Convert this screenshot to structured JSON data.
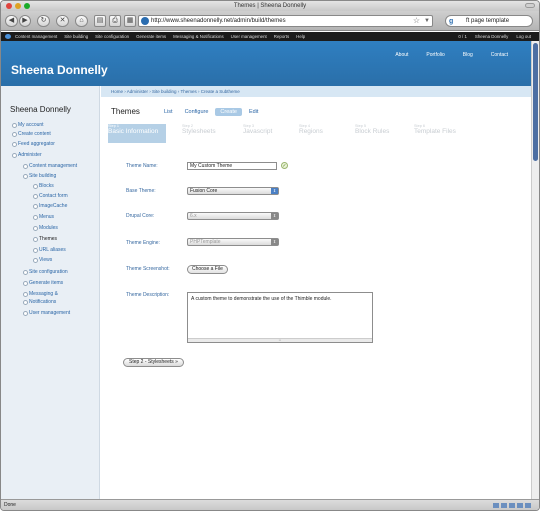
{
  "window": {
    "title": "Themes | Sheena Donnelly"
  },
  "browser": {
    "url": "http://www.sheenadonnelly.net/admin/build/themes",
    "search_text": "ft page template",
    "status": "Done"
  },
  "admin_menu": {
    "items": [
      "Content management",
      "Site building",
      "Site configuration",
      "Generate items",
      "Messaging & Notifications",
      "User management",
      "Reports",
      "Help"
    ],
    "counter": "0 / 1",
    "user": "Sheena Donnelly",
    "logout": "Log out"
  },
  "header": {
    "site_name": "Sheena Donnelly",
    "nav": [
      "About",
      "Portfolio",
      "Blog",
      "Contact"
    ]
  },
  "sidebar": {
    "title": "Sheena Donnelly",
    "items": [
      {
        "label": "My account"
      },
      {
        "label": "Create content"
      },
      {
        "label": "Feed aggregator"
      },
      {
        "label": "Administer"
      },
      {
        "label": "Content management"
      },
      {
        "label": "Site building"
      },
      {
        "label": "Blocks"
      },
      {
        "label": "Contact form"
      },
      {
        "label": "ImageCache"
      },
      {
        "label": "Menus"
      },
      {
        "label": "Modules"
      },
      {
        "label": "Themes"
      },
      {
        "label": "URL aliases"
      },
      {
        "label": "Views"
      },
      {
        "label": "Site configuration"
      },
      {
        "label": "Generate items"
      },
      {
        "label": "Messaging &"
      },
      {
        "label": "Notifications"
      },
      {
        "label": "User management"
      }
    ]
  },
  "content": {
    "breadcrumb": "Home › Administer › Site building › Themes › Create a Subtheme",
    "title": "Themes",
    "tabs": [
      "List",
      "Configure",
      "Create",
      "Edit"
    ],
    "steps": [
      {
        "num": "Step 1",
        "title": "Basic Information"
      },
      {
        "num": "Step 2",
        "title": "Stylesheets"
      },
      {
        "num": "Step 3",
        "title": "Javascript"
      },
      {
        "num": "Step 4",
        "title": "Regions"
      },
      {
        "num": "Step 5",
        "title": "Block Rules"
      },
      {
        "num": "Step 6",
        "title": "Template Files"
      }
    ],
    "form": {
      "theme_name_label": "Theme Name:",
      "theme_name_value": "My Custom Theme",
      "base_theme_label": "Base Theme:",
      "base_theme_value": "Fusion Core",
      "drupal_core_label": "Drupal Core:",
      "drupal_core_value": "6.x",
      "theme_engine_label": "Theme Engine:",
      "theme_engine_value": "PHPTemplate",
      "screenshot_label": "Theme Screenshot:",
      "choose_file": "Choose a File",
      "description_label": "Theme Description:",
      "description_value": "A custom theme to demonstrate the use of the Thimble module.",
      "next_button": "Step 2 - Stylesheets »"
    }
  }
}
